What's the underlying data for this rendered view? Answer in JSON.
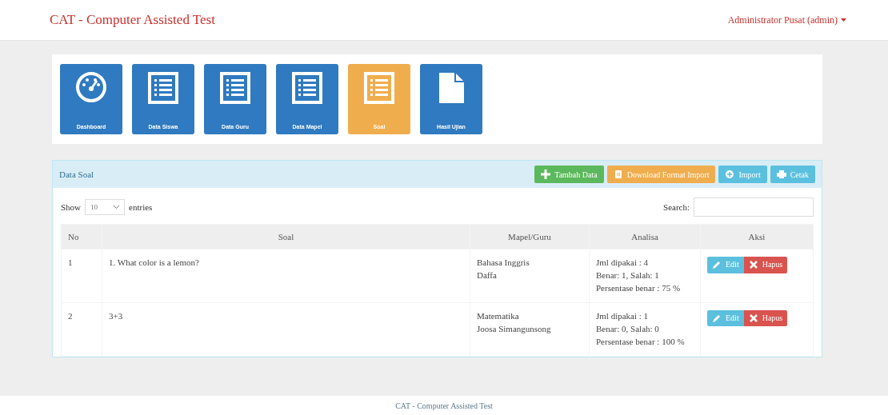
{
  "navbar": {
    "brand": "CAT - Computer Assisted Test",
    "user_menu": "Administrator Pusat (admin)"
  },
  "tiles": [
    {
      "label": "Dashboard",
      "kind": "dashboard",
      "selected": false
    },
    {
      "label": "Data Siswa",
      "kind": "list",
      "selected": false
    },
    {
      "label": "Data Guru",
      "kind": "list",
      "selected": false
    },
    {
      "label": "Data Mapel",
      "kind": "list",
      "selected": false
    },
    {
      "label": "Soal",
      "kind": "list",
      "selected": true
    },
    {
      "label": "Hasil Ujian",
      "kind": "file",
      "selected": false
    }
  ],
  "panel": {
    "title": "Data Soal",
    "buttons": [
      {
        "label": "Tambah Data",
        "kind": "add"
      },
      {
        "label": "Download Format Import",
        "kind": "download"
      },
      {
        "label": "Import",
        "kind": "import"
      },
      {
        "label": "Cetak",
        "kind": "print"
      }
    ],
    "show_label": "Show",
    "entries_value": "10",
    "entries_label": "entries",
    "search_label": "Search:",
    "table": {
      "columns": [
        "No",
        "Soal",
        "Mapel/Guru",
        "Analisa",
        "Aksi"
      ],
      "rows": [
        {
          "no": "1",
          "soal": "1. What color is a lemon?",
          "mapel_guru": [
            "Bahasa Inggris",
            "Daffa"
          ],
          "analisa": [
            "Jml dipakai : 4",
            "Benar: 1, Salah: 1",
            "Persentase benar : 75 %"
          ],
          "actions": [
            {
              "label": "Edit",
              "kind": "edit"
            },
            {
              "label": "Hapus",
              "kind": "delete"
            }
          ]
        },
        {
          "no": "2",
          "soal": "3+3",
          "mapel_guru": [
            "Matematika",
            "Joosa Simangunsong"
          ],
          "analisa": [
            "Jml dipakai : 1",
            "Benar: 0, Salah: 0",
            "Persentase benar : 100 %"
          ],
          "actions": [
            {
              "label": "Edit",
              "kind": "edit"
            },
            {
              "label": "Hapus",
              "kind": "delete"
            }
          ]
        }
      ]
    }
  },
  "footer": "CAT - Computer Assisted Test"
}
